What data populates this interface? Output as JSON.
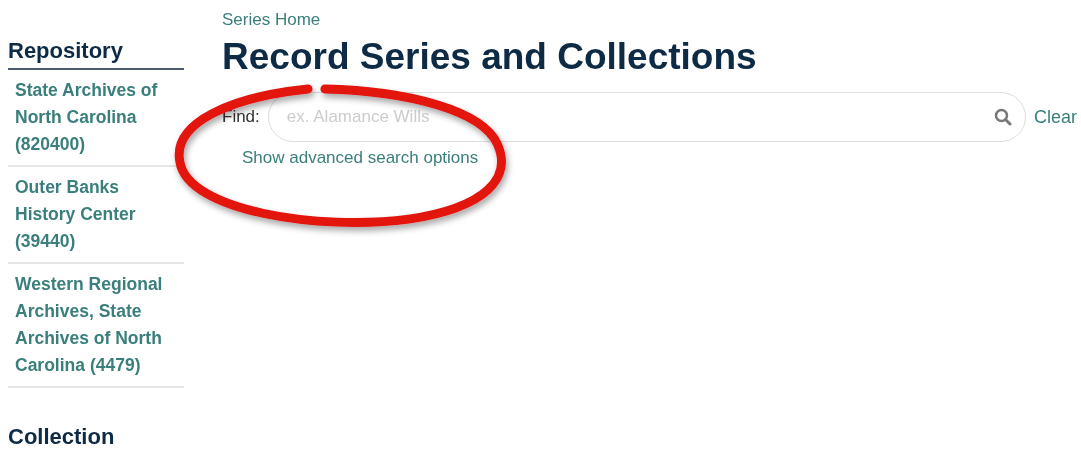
{
  "breadcrumb": "Series Home",
  "sidebar": {
    "sections": [
      {
        "heading": "Repository",
        "items": [
          {
            "label": "State Archives of North Carolina (820400)"
          },
          {
            "label": "Outer Banks History Center (39440)"
          },
          {
            "label": "Western Regional Archives, State Archives of North Carolina (4479)"
          }
        ]
      },
      {
        "heading": "Collection"
      }
    ]
  },
  "title": "Record Series and Collections",
  "search": {
    "label": "Find:",
    "placeholder": "ex. Alamance Wills",
    "clear": "Clear",
    "advanced_link": "Show advanced search options"
  },
  "annotation": {
    "kind": "circle",
    "color": "#e3120f"
  }
}
